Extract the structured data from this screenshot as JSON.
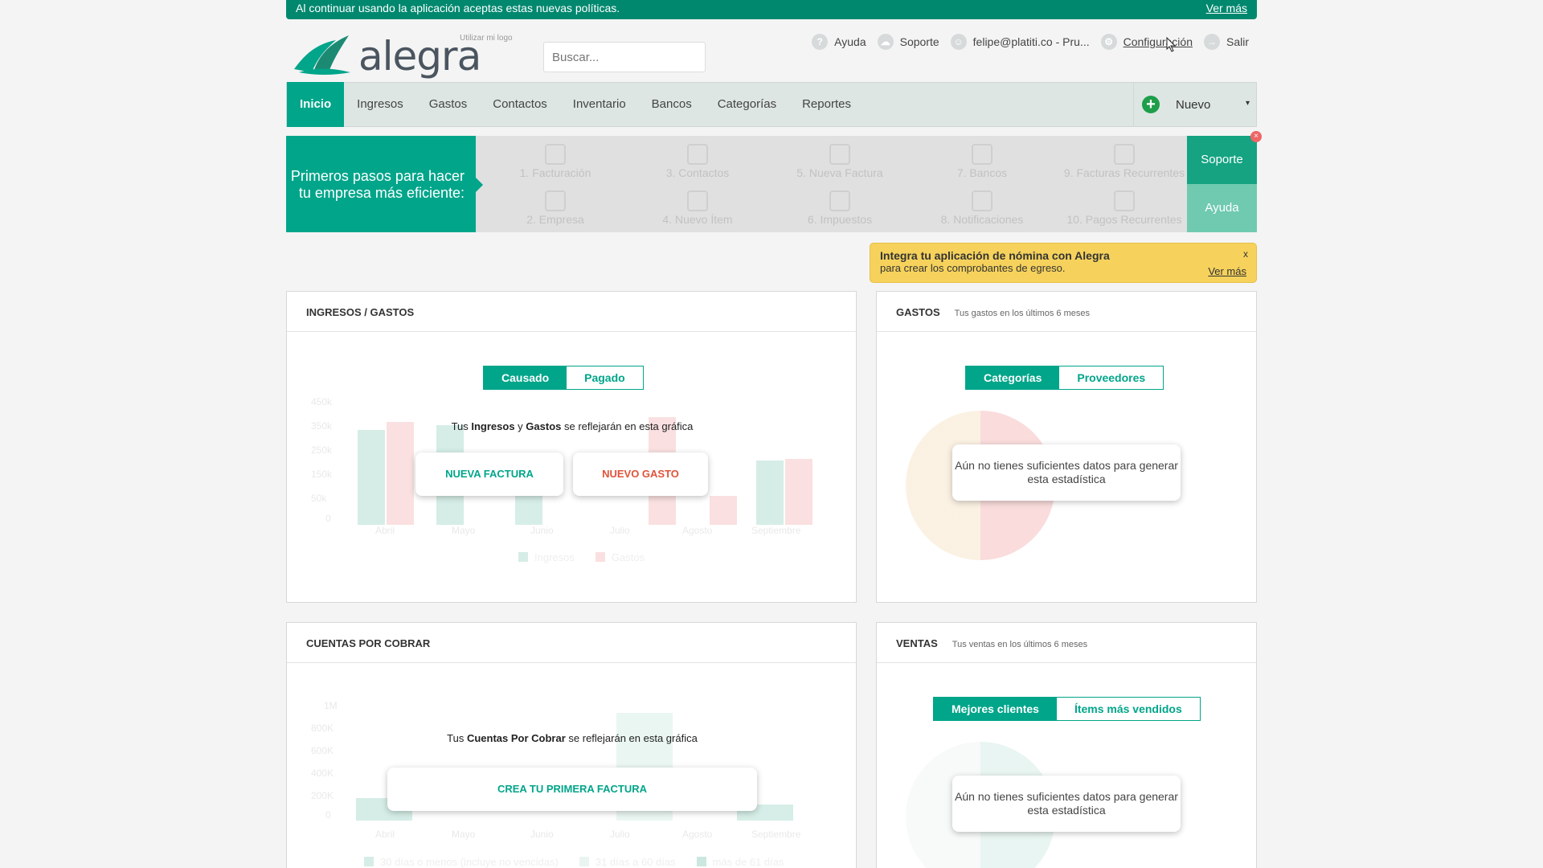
{
  "notice": {
    "text": "Al continuar usando la aplicación aceptas estas nuevas políticas.",
    "link": "Ver más"
  },
  "header": {
    "logo_text": "alegra",
    "logo_hint": "Utilizar mi logo",
    "search_placeholder": "Buscar...",
    "links": {
      "help": "Ayuda",
      "support": "Soporte",
      "user": "felipe@platiti.co - Pru...",
      "settings": "Configuración",
      "logout": "Salir"
    }
  },
  "nav": {
    "items": [
      "Inicio",
      "Ingresos",
      "Gastos",
      "Contactos",
      "Inventario",
      "Bancos",
      "Categorías",
      "Reportes"
    ],
    "new_label": "Nuevo"
  },
  "first_steps": {
    "intro": "Primeros pasos para hacer tu empresa más eficiente:",
    "steps": [
      "1. Facturación",
      "3. Contactos",
      "5. Nueva Factura",
      "7. Bancos",
      "9. Facturas Recurrentes",
      "2. Empresa",
      "4. Nuevo Ítem",
      "6. Impuestos",
      "8. Notificaciones",
      "10. Pagos Recurrentes"
    ],
    "support": "Soporte",
    "help": "Ayuda"
  },
  "promo": {
    "title": "Integra tu aplicación de nómina con Alegra",
    "text": "para crear los comprobantes de egreso.",
    "close": "x",
    "more": "Ver más"
  },
  "income_expense": {
    "title": "INGRESOS / GASTOS",
    "toggle": [
      "Causado",
      "Pagado"
    ],
    "msg": {
      "pre": "Tus ",
      "a": "Ingresos",
      "mid": " y ",
      "b": "Gastos",
      "post": " se reflejarán en esta gráfica"
    },
    "btn_invoice": "NUEVA FACTURA",
    "btn_expense": "NUEVO GASTO",
    "y_ticks": [
      "450k",
      "350k",
      "250k",
      "150k",
      "50k",
      "0"
    ],
    "months": [
      "Abril",
      "Mayo",
      "Junio",
      "Julio",
      "Agosto",
      "Septiembre"
    ],
    "legend": [
      "Ingresos",
      "Gastos"
    ],
    "colors": {
      "income": "#7fc9b4",
      "expense": "#f0a0a0"
    }
  },
  "expenses": {
    "title": "GASTOS",
    "subtitle": "Tus gastos en los últimos 6 meses",
    "toggle": [
      "Categorías",
      "Proveedores"
    ],
    "empty": "Aún no tienes suficientes datos para generar esta estadística"
  },
  "receivables": {
    "title": "CUENTAS POR COBRAR",
    "msg": {
      "pre": "Tus ",
      "a": "Cuentas Por Cobrar",
      "post": " se reflejarán en esta gráfica"
    },
    "btn": "CREA TU PRIMERA FACTURA",
    "y_ticks": [
      "1M",
      "800K",
      "600K",
      "400K",
      "200K",
      "0"
    ],
    "months": [
      "Abril",
      "Mayo",
      "Junio",
      "Julio",
      "Agosto",
      "Septiembre"
    ],
    "legend": [
      "30 días o menos (incluye no vencidas)",
      "31 días a 60 días",
      "más de 61 días"
    ]
  },
  "sales": {
    "title": "VENTAS",
    "subtitle": "Tus ventas en los últimos 6 meses",
    "toggle": [
      "Mejores clientes",
      "Ítems más vendidos"
    ],
    "empty": "Aún no tienes suficientes datos para generar esta estadística"
  }
}
